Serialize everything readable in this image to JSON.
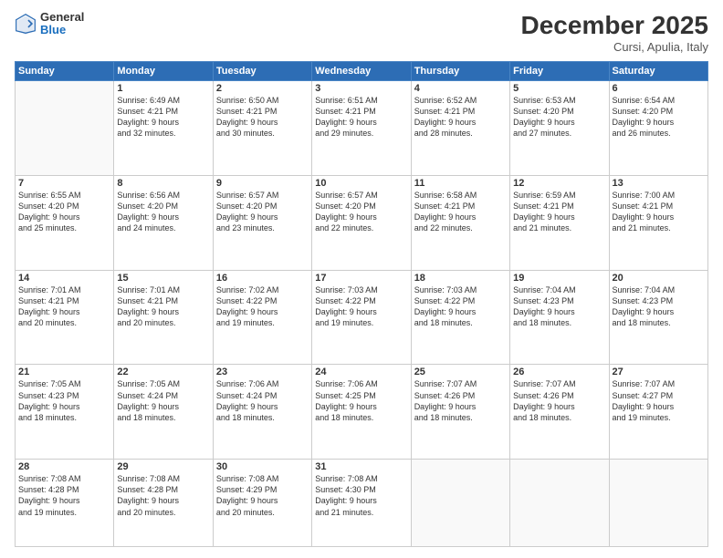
{
  "header": {
    "logo_general": "General",
    "logo_blue": "Blue",
    "month_title": "December 2025",
    "location": "Cursi, Apulia, Italy"
  },
  "days_of_week": [
    "Sunday",
    "Monday",
    "Tuesday",
    "Wednesday",
    "Thursday",
    "Friday",
    "Saturday"
  ],
  "weeks": [
    [
      {
        "day": "",
        "text": ""
      },
      {
        "day": "1",
        "text": "Sunrise: 6:49 AM\nSunset: 4:21 PM\nDaylight: 9 hours\nand 32 minutes."
      },
      {
        "day": "2",
        "text": "Sunrise: 6:50 AM\nSunset: 4:21 PM\nDaylight: 9 hours\nand 30 minutes."
      },
      {
        "day": "3",
        "text": "Sunrise: 6:51 AM\nSunset: 4:21 PM\nDaylight: 9 hours\nand 29 minutes."
      },
      {
        "day": "4",
        "text": "Sunrise: 6:52 AM\nSunset: 4:21 PM\nDaylight: 9 hours\nand 28 minutes."
      },
      {
        "day": "5",
        "text": "Sunrise: 6:53 AM\nSunset: 4:20 PM\nDaylight: 9 hours\nand 27 minutes."
      },
      {
        "day": "6",
        "text": "Sunrise: 6:54 AM\nSunset: 4:20 PM\nDaylight: 9 hours\nand 26 minutes."
      }
    ],
    [
      {
        "day": "7",
        "text": "Sunrise: 6:55 AM\nSunset: 4:20 PM\nDaylight: 9 hours\nand 25 minutes."
      },
      {
        "day": "8",
        "text": "Sunrise: 6:56 AM\nSunset: 4:20 PM\nDaylight: 9 hours\nand 24 minutes."
      },
      {
        "day": "9",
        "text": "Sunrise: 6:57 AM\nSunset: 4:20 PM\nDaylight: 9 hours\nand 23 minutes."
      },
      {
        "day": "10",
        "text": "Sunrise: 6:57 AM\nSunset: 4:20 PM\nDaylight: 9 hours\nand 22 minutes."
      },
      {
        "day": "11",
        "text": "Sunrise: 6:58 AM\nSunset: 4:21 PM\nDaylight: 9 hours\nand 22 minutes."
      },
      {
        "day": "12",
        "text": "Sunrise: 6:59 AM\nSunset: 4:21 PM\nDaylight: 9 hours\nand 21 minutes."
      },
      {
        "day": "13",
        "text": "Sunrise: 7:00 AM\nSunset: 4:21 PM\nDaylight: 9 hours\nand 21 minutes."
      }
    ],
    [
      {
        "day": "14",
        "text": "Sunrise: 7:01 AM\nSunset: 4:21 PM\nDaylight: 9 hours\nand 20 minutes."
      },
      {
        "day": "15",
        "text": "Sunrise: 7:01 AM\nSunset: 4:21 PM\nDaylight: 9 hours\nand 20 minutes."
      },
      {
        "day": "16",
        "text": "Sunrise: 7:02 AM\nSunset: 4:22 PM\nDaylight: 9 hours\nand 19 minutes."
      },
      {
        "day": "17",
        "text": "Sunrise: 7:03 AM\nSunset: 4:22 PM\nDaylight: 9 hours\nand 19 minutes."
      },
      {
        "day": "18",
        "text": "Sunrise: 7:03 AM\nSunset: 4:22 PM\nDaylight: 9 hours\nand 18 minutes."
      },
      {
        "day": "19",
        "text": "Sunrise: 7:04 AM\nSunset: 4:23 PM\nDaylight: 9 hours\nand 18 minutes."
      },
      {
        "day": "20",
        "text": "Sunrise: 7:04 AM\nSunset: 4:23 PM\nDaylight: 9 hours\nand 18 minutes."
      }
    ],
    [
      {
        "day": "21",
        "text": "Sunrise: 7:05 AM\nSunset: 4:23 PM\nDaylight: 9 hours\nand 18 minutes."
      },
      {
        "day": "22",
        "text": "Sunrise: 7:05 AM\nSunset: 4:24 PM\nDaylight: 9 hours\nand 18 minutes."
      },
      {
        "day": "23",
        "text": "Sunrise: 7:06 AM\nSunset: 4:24 PM\nDaylight: 9 hours\nand 18 minutes."
      },
      {
        "day": "24",
        "text": "Sunrise: 7:06 AM\nSunset: 4:25 PM\nDaylight: 9 hours\nand 18 minutes."
      },
      {
        "day": "25",
        "text": "Sunrise: 7:07 AM\nSunset: 4:26 PM\nDaylight: 9 hours\nand 18 minutes."
      },
      {
        "day": "26",
        "text": "Sunrise: 7:07 AM\nSunset: 4:26 PM\nDaylight: 9 hours\nand 18 minutes."
      },
      {
        "day": "27",
        "text": "Sunrise: 7:07 AM\nSunset: 4:27 PM\nDaylight: 9 hours\nand 19 minutes."
      }
    ],
    [
      {
        "day": "28",
        "text": "Sunrise: 7:08 AM\nSunset: 4:28 PM\nDaylight: 9 hours\nand 19 minutes."
      },
      {
        "day": "29",
        "text": "Sunrise: 7:08 AM\nSunset: 4:28 PM\nDaylight: 9 hours\nand 20 minutes."
      },
      {
        "day": "30",
        "text": "Sunrise: 7:08 AM\nSunset: 4:29 PM\nDaylight: 9 hours\nand 20 minutes."
      },
      {
        "day": "31",
        "text": "Sunrise: 7:08 AM\nSunset: 4:30 PM\nDaylight: 9 hours\nand 21 minutes."
      },
      {
        "day": "",
        "text": ""
      },
      {
        "day": "",
        "text": ""
      },
      {
        "day": "",
        "text": ""
      }
    ]
  ]
}
